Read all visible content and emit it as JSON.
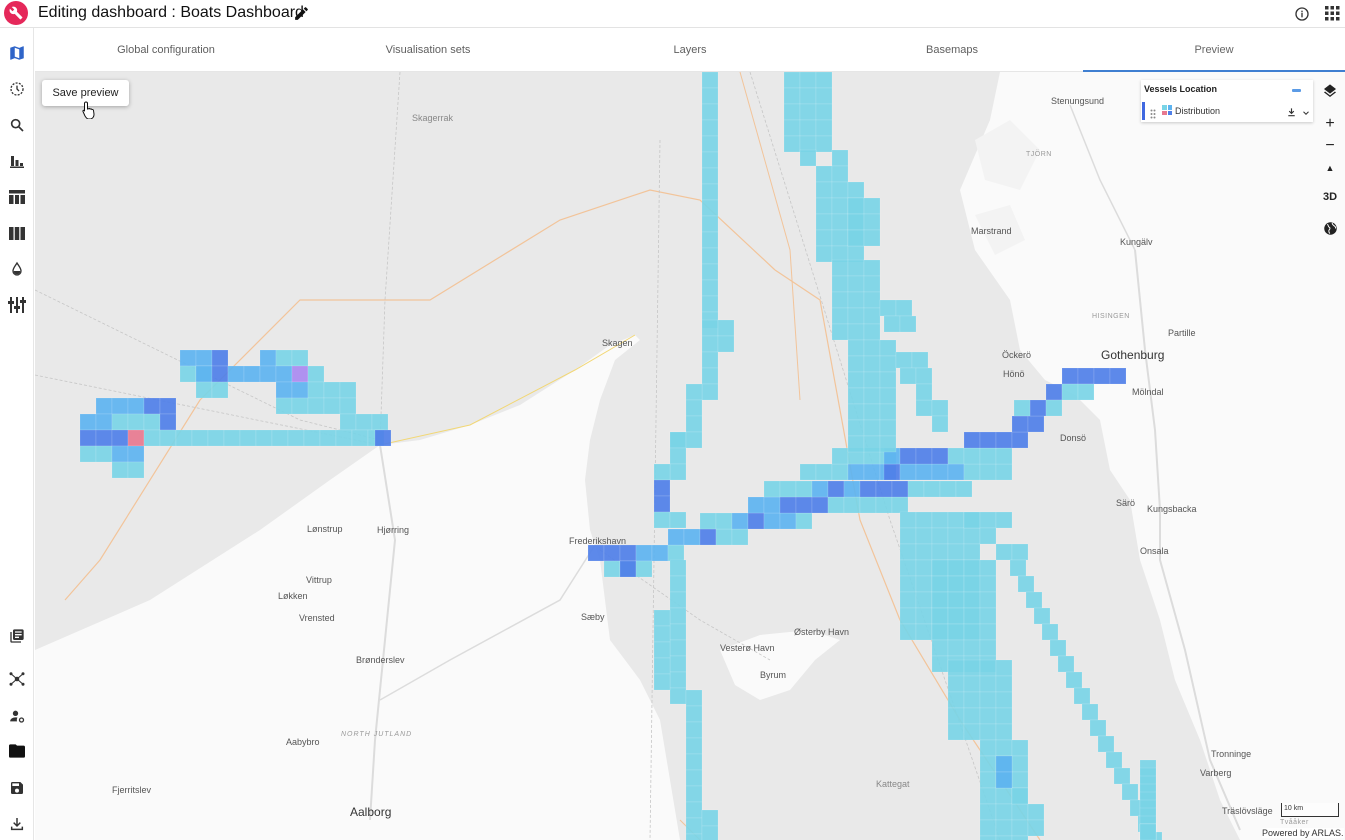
{
  "header": {
    "title": "Editing dashboard : Boats Dashboard"
  },
  "tabs": [
    {
      "label": "Global configuration"
    },
    {
      "label": "Visualisation sets"
    },
    {
      "label": "Layers"
    },
    {
      "label": "Basemaps"
    },
    {
      "label": "Preview",
      "active": true
    }
  ],
  "sidebar": {
    "icons": [
      "map-icon",
      "history-icon",
      "search-icon",
      "bar-chart-icon",
      "table-icon",
      "columns-icon",
      "drop-icon",
      "filters-icon",
      "book-icon",
      "network-icon",
      "user-settings-icon",
      "folder-icon",
      "save-icon",
      "download-icon"
    ]
  },
  "map": {
    "save_preview_label": "Save preview",
    "legend": {
      "title": "Vessels Location",
      "layer_label": "Distribution"
    },
    "controls": {
      "zoom_in": "+",
      "zoom_out": "−",
      "compass": "▲",
      "three_d": "3D"
    },
    "scale_label": "10 km",
    "attribution": "Powered by ARLAS.",
    "places": [
      "Skagerrak",
      "Skagen",
      "Hjørring",
      "Frederikshavn",
      "Sæby",
      "Løkken",
      "Vrensted",
      "Lønstrup",
      "Vittrup",
      "Brønderslev",
      "NORTH JUTLAND",
      "Aabybro",
      "Fjerritslev",
      "Aalborg",
      "Kattegat",
      "Østerby Havn",
      "Vesterø Havn",
      "Byrum",
      "Stenungsund",
      "TJÖRN",
      "Marstrand",
      "Kungälv",
      "HISINGEN",
      "Gothenburg",
      "Partille",
      "Öckerö",
      "Hönö",
      "Mölndal",
      "Donsö",
      "Särö",
      "Kungsbacka",
      "Onsala",
      "Tronninge",
      "Varberg",
      "Träslövsläge",
      "Tvååker"
    ]
  },
  "colors": {
    "brand": "#e5285a",
    "cell_low": "#79d4e6",
    "cell_mid": "#5db3f0",
    "cell_high": "#4f7fe8",
    "cell_peak": "#e7788f",
    "cell_purple": "#a98af0",
    "tab_active": "#3f7fd1"
  }
}
